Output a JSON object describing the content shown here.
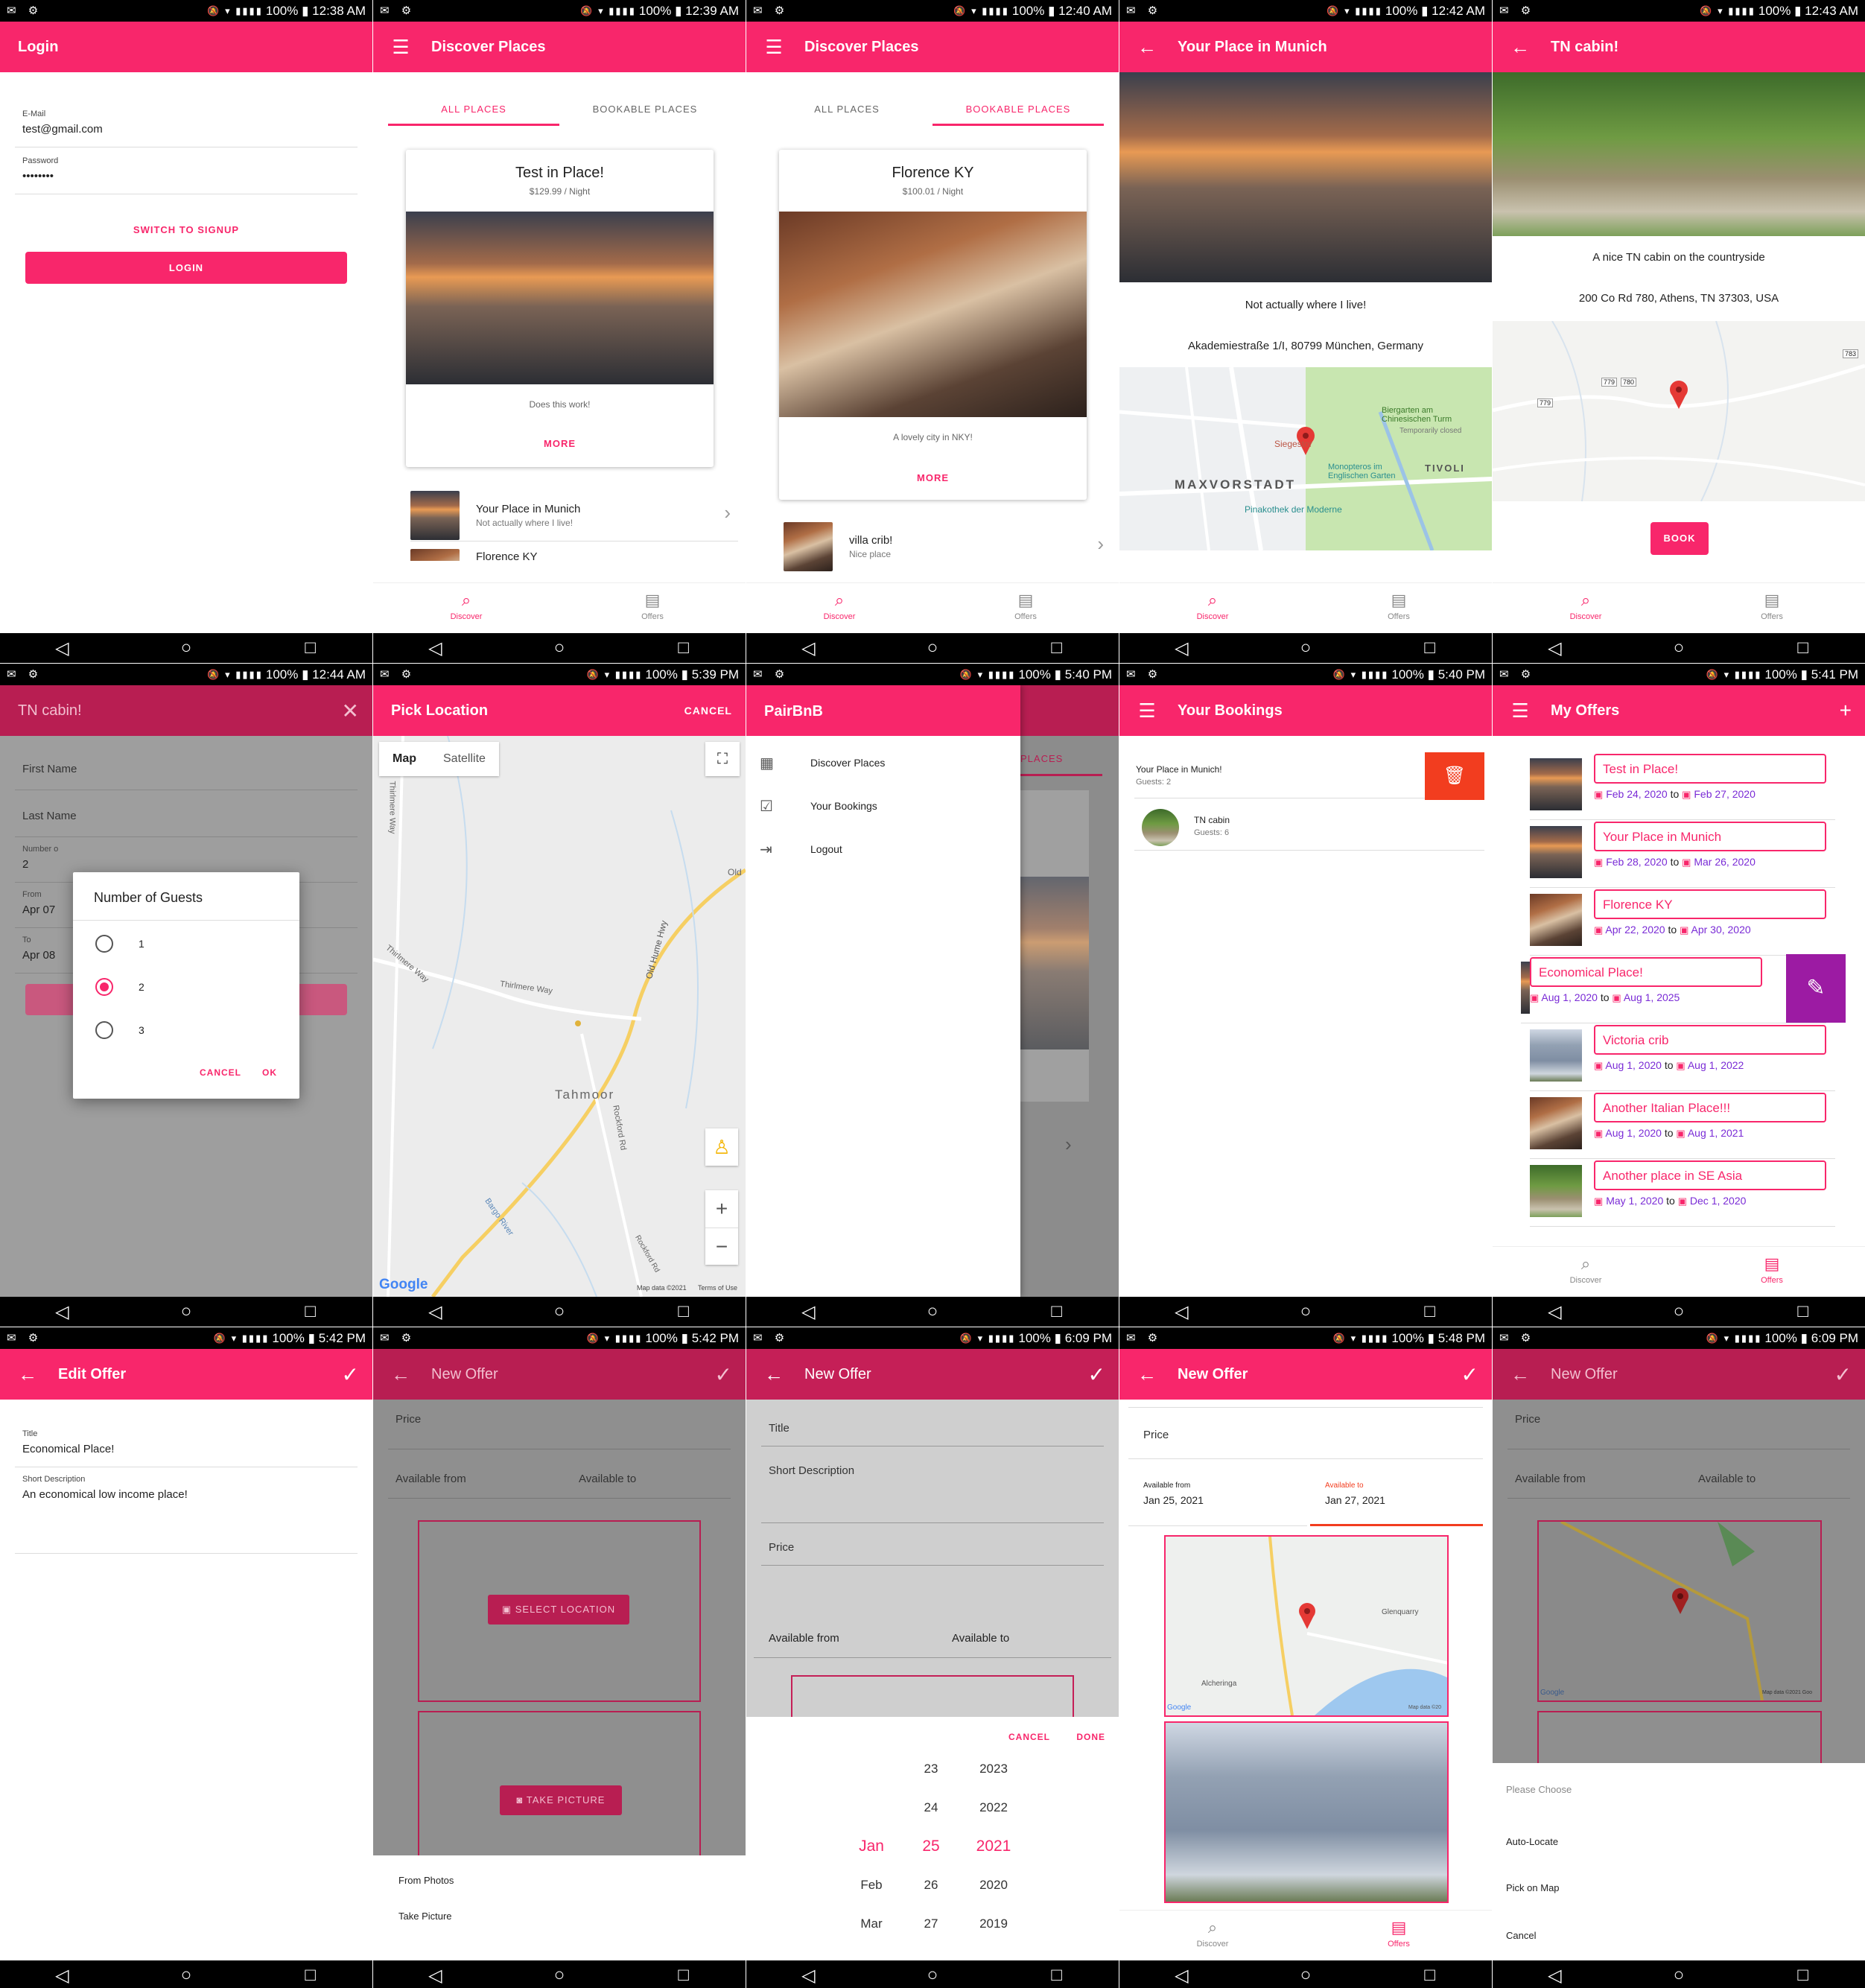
{
  "brand": {
    "primary": "#f8266b",
    "overlay_title": "#b81e52",
    "purple": "#7a2bd6",
    "fab_purple": "#9c1ba3",
    "delete_red": "#f23d1f"
  },
  "icons": {
    "menu": "☰",
    "back": "←",
    "close": "✕",
    "check": "✓",
    "plus": "+",
    "chevron": "›",
    "trash": "🗑",
    "pencil": "✎",
    "calendar": "▣",
    "search": "⌕",
    "offers": "▤",
    "nav_back": "◁",
    "nav_home": "○",
    "nav_recent": "□",
    "fullscreen": "⛶",
    "pegman": "♙",
    "zoom_in": "+",
    "zoom_out": "−"
  },
  "screens": {
    "login": {
      "time": "12:38 AM",
      "battery": "100%",
      "title": "Login",
      "email_label": "E-Mail",
      "email_value": "test@gmail.com",
      "password_label": "Password",
      "password_value": "••••••••",
      "switch_label": "SWITCH TO SIGNUP",
      "login_label": "LOGIN"
    },
    "discover_all": {
      "time": "12:39 AM",
      "battery": "100%",
      "title": "Discover Places",
      "tab_all": "ALL PLACES",
      "tab_bookable": "BOOKABLE PLACES",
      "card_title": "Test in Place!",
      "card_price": "$129.99 / Night",
      "card_desc": "Does this work!",
      "card_more": "MORE",
      "row1_title": "Your Place in Munich",
      "row1_sub": "Not actually where I live!",
      "row2_title": "Florence KY",
      "nav_discover": "Discover",
      "nav_offers": "Offers"
    },
    "discover_bookable": {
      "time": "12:40 AM",
      "battery": "100%",
      "title": "Discover Places",
      "tab_all": "ALL PLACES",
      "tab_bookable": "BOOKABLE PLACES",
      "card_title": "Florence KY",
      "card_price": "$100.01 / Night",
      "card_desc": "A lovely city in NKY!",
      "card_more": "MORE",
      "row1_title": "villa crib!",
      "row1_sub": "Nice place",
      "nav_discover": "Discover",
      "nav_offers": "Offers"
    },
    "munich": {
      "time": "12:42 AM",
      "battery": "100%",
      "title": "Your Place in Munich",
      "desc": "Not actually where I live!",
      "address": "Akademiestraße 1/I, 80799 München, Germany",
      "map_labels": [
        "MAXVORSTADT",
        "TIVOLI",
        "Siegestor",
        "Biergarten am Chinesischen Turm",
        "Temporarily closed",
        "Monopteros im Englischen Garten",
        "Pinakothek der Moderne"
      ],
      "nav_discover": "Discover",
      "nav_offers": "Offers"
    },
    "tn": {
      "time": "12:43 AM",
      "battery": "100%",
      "title": "TN cabin!",
      "desc": "A nice TN cabin on the countryside",
      "address": "200 Co Rd 780, Athens, TN 37303, USA",
      "book": "BOOK",
      "map_labels": [
        "780",
        "779",
        "779",
        "783"
      ],
      "nav_discover": "Discover",
      "nav_offers": "Offers"
    },
    "booking": {
      "time": "12:44 AM",
      "battery": "100%",
      "title": "TN cabin!",
      "first_name": "First Name",
      "last_name": "Last Name",
      "number_label": "Number o",
      "number_value": "2",
      "from_label": "From",
      "from_value": "Apr 07",
      "to_label": "To",
      "to_value": "Apr 08",
      "dialog_title": "Number of Guests",
      "options": [
        "1",
        "2",
        "3"
      ],
      "cancel": "CANCEL",
      "ok": "OK"
    },
    "pick": {
      "time": "5:39 PM",
      "battery": "100%",
      "title": "Pick Location",
      "cancel": "CANCEL",
      "map_tab": "Map",
      "sat_tab": "Satellite",
      "labels": [
        "Tahmoor",
        "Old Hume Hwy",
        "Thirlmere Way",
        "Thirlmere Way",
        "Thirlmere Way",
        "Rockford Rd",
        "Bargo River",
        "Rockford Rd",
        "Old"
      ],
      "google": "Google",
      "attrib": "Map data ©2021",
      "terms": "Terms of Use"
    },
    "drawer": {
      "time": "5:40 PM",
      "battery": "100%",
      "title": "PairBnB",
      "items": [
        "Discover Places",
        "Your Bookings",
        "Logout"
      ],
      "behind_tab": "PLACES"
    },
    "bookings": {
      "time": "5:40 PM",
      "battery": "100%",
      "title": "Your Bookings",
      "b1_title": "Your Place in Munich!",
      "b1_sub": "Guests: 2",
      "b2_title": "TN cabin",
      "b2_sub": "Guests: 6"
    },
    "offers": {
      "time": "5:41 PM",
      "battery": "100%",
      "title": "My Offers",
      "to": "to",
      "items": [
        {
          "title": "Test in Place!",
          "from": "Feb 24, 2020",
          "until": "Feb 27, 2020"
        },
        {
          "title": "Your Place in Munich",
          "from": "Feb 28, 2020",
          "until": "Mar 26, 2020"
        },
        {
          "title": "Florence KY",
          "from": "Apr 22, 2020",
          "until": "Apr 30, 2020"
        },
        {
          "title": "Economical Place!",
          "from": "Aug 1, 2020",
          "until": "Aug 1, 2025"
        },
        {
          "title": "Victoria crib",
          "from": "Aug 1, 2020",
          "until": "Aug 1, 2022"
        },
        {
          "title": "Another Italian Place!!!",
          "from": "Aug 1, 2020",
          "until": "Aug 1, 2021"
        },
        {
          "title": "Another place in SE Asia",
          "from": "May 1, 2020",
          "until": "Dec 1, 2020"
        }
      ],
      "nav_discover": "Discover",
      "nav_offers": "Offers"
    },
    "edit": {
      "time": "5:42 PM",
      "battery": "100%",
      "title": "Edit Offer",
      "title_label": "Title",
      "title_value": "Economical Place!",
      "desc_label": "Short Description",
      "desc_value": "An economical low income place!"
    },
    "new1": {
      "time": "5:42 PM",
      "battery": "100%",
      "title": "New Offer",
      "price": "Price",
      "avail_from": "Available from",
      "avail_to": "Available to",
      "select_loc": "SELECT LOCATION",
      "take_pic": "TAKE PICTURE",
      "sheet1": "From Photos",
      "sheet2": "Take Picture",
      "nav_discover": "Discover",
      "nav_offers": "Offers"
    },
    "new2": {
      "time": "6:09 PM",
      "battery": "100%",
      "title": "New Offer",
      "title_ph": "Title",
      "desc_ph": "Short Description",
      "price": "Price",
      "avail_from": "Available from",
      "avail_to": "Available to",
      "cancel": "CANCEL",
      "done": "DONE",
      "months": [
        "Jan",
        "Feb",
        "Mar"
      ],
      "days": [
        "23",
        "24",
        "25",
        "26",
        "27"
      ],
      "years": [
        "2023",
        "2022",
        "2021",
        "2020",
        "2019"
      ]
    },
    "new3": {
      "time": "5:48 PM",
      "battery": "100%",
      "title": "New Offer",
      "price": "Price",
      "from_label": "Available from",
      "from_value": "Jan 25, 2021",
      "to_label": "Available to",
      "to_value": "Jan 27, 2021",
      "map_labels": [
        "Glenquarry",
        "Alcheringa"
      ],
      "google": "Google",
      "attrib": "Map data ©20",
      "nav_discover": "Discover",
      "nav_offers": "Offers"
    },
    "new4": {
      "time": "6:09 PM",
      "battery": "100%",
      "title": "New Offer",
      "price": "Price",
      "avail_from": "Available from",
      "avail_to": "Available to",
      "sheet_title": "Please Choose",
      "sheet_items": [
        "Auto-Locate",
        "Pick on Map",
        "Cancel"
      ],
      "google": "Google",
      "attrib": "Map data ©2021 Goo"
    }
  }
}
